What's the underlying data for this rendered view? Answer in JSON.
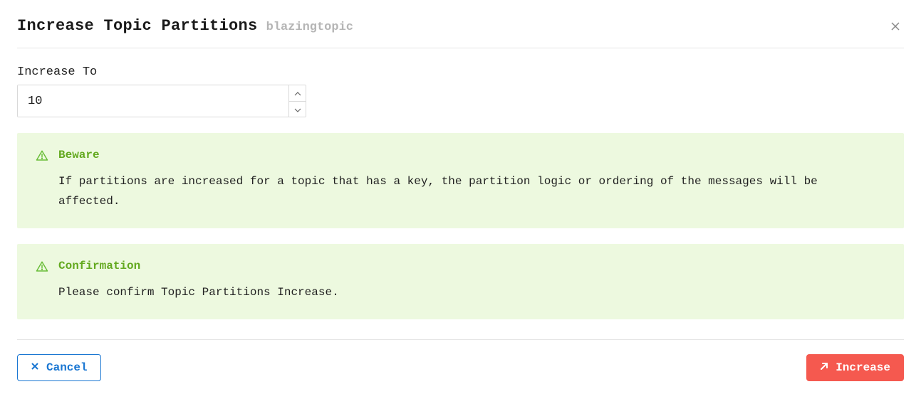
{
  "header": {
    "title": "Increase Topic Partitions",
    "topic_name": "blazingtopic"
  },
  "field": {
    "label": "Increase To",
    "value": "10"
  },
  "alerts": {
    "beware": {
      "title": "Beware",
      "message": "If partitions are increased for a topic that has a key, the partition logic or ordering of the messages will be affected."
    },
    "confirmation": {
      "title": "Confirmation",
      "message": "Please confirm Topic Partitions Increase."
    }
  },
  "footer": {
    "cancel": "Cancel",
    "submit": "Increase"
  }
}
